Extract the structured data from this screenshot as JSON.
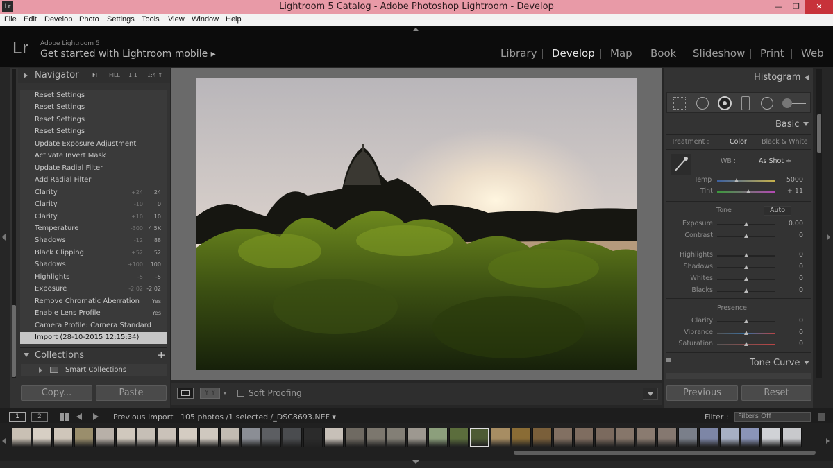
{
  "window": {
    "title": "Lightroom 5 Catalog - Adobe Photoshop Lightroom - Develop",
    "app_icon": "Lr",
    "min_glyph": "—",
    "max_glyph": "❐",
    "close_glyph": "✕"
  },
  "menu": [
    "File",
    "Edit",
    "Develop",
    "Photo",
    "Settings",
    "Tools",
    "View",
    "Window",
    "Help"
  ],
  "identity": {
    "logo": "Lr",
    "product": "Adobe Lightroom 5",
    "mobile": "Get started with Lightroom mobile ▸"
  },
  "modules": [
    "Library",
    "Develop",
    "Map",
    "Book",
    "Slideshow",
    "Print",
    "Web"
  ],
  "active_module": "Develop",
  "navigator": {
    "title": "Navigator",
    "options": [
      "FIT",
      "FILL",
      "1:1",
      "1:4 ⇕"
    ]
  },
  "history": [
    {
      "label": "Reset Settings",
      "v1": "",
      "v2": ""
    },
    {
      "label": "Reset Settings",
      "v1": "",
      "v2": ""
    },
    {
      "label": "Reset Settings",
      "v1": "",
      "v2": ""
    },
    {
      "label": "Reset Settings",
      "v1": "",
      "v2": ""
    },
    {
      "label": "Update Exposure Adjustment",
      "v1": "",
      "v2": ""
    },
    {
      "label": "Activate Invert Mask",
      "v1": "",
      "v2": ""
    },
    {
      "label": "Update Radial Filter",
      "v1": "",
      "v2": ""
    },
    {
      "label": "Add Radial Filter",
      "v1": "",
      "v2": ""
    },
    {
      "label": "Clarity",
      "v1": "+24",
      "v2": "24"
    },
    {
      "label": "Clarity",
      "v1": "-10",
      "v2": "0"
    },
    {
      "label": "Clarity",
      "v1": "+10",
      "v2": "10"
    },
    {
      "label": "Temperature",
      "v1": "-300",
      "v2": "4.5K"
    },
    {
      "label": "Shadows",
      "v1": "-12",
      "v2": "88"
    },
    {
      "label": "Black Clipping",
      "v1": "+52",
      "v2": "52"
    },
    {
      "label": "Shadows",
      "v1": "+100",
      "v2": "100"
    },
    {
      "label": "Highlights",
      "v1": "-5",
      "v2": "-5"
    },
    {
      "label": "Exposure",
      "v1": "-2.02",
      "v2": "-2.02"
    },
    {
      "label": "Remove Chromatic Aberration",
      "v1": "",
      "v2": "Yes"
    },
    {
      "label": "Enable Lens Profile",
      "v1": "",
      "v2": "Yes"
    },
    {
      "label": "Camera Profile: Camera Standard",
      "v1": "",
      "v2": ""
    },
    {
      "label": "Import (28-10-2015 12:15:34)",
      "v1": "",
      "v2": ""
    }
  ],
  "collections": {
    "title": "Collections",
    "plus": "+",
    "smart": "Smart Collections"
  },
  "left_buttons": {
    "copy": "Copy...",
    "paste": "Paste"
  },
  "toolbar": {
    "soft_proofing": "Soft Proofing",
    "yy": "Y|Y"
  },
  "right": {
    "histogram": "Histogram",
    "basic": "Basic",
    "treatment_label": "Treatment :",
    "treatment_color": "Color",
    "treatment_bw": "Black & White",
    "wb_label": "WB :",
    "wb_value": "As Shot ÷",
    "temp_label": "Temp",
    "temp_value": "5000",
    "tint_label": "Tint",
    "tint_value": "+ 11",
    "tone_label": "Tone",
    "auto_label": "Auto",
    "presence_label": "Presence",
    "tone_curve": "Tone Curve",
    "previous": "Previous",
    "reset": "Reset"
  },
  "sliders": [
    {
      "label": "Exposure",
      "value": "0.00",
      "pos": 0.5
    },
    {
      "label": "Contrast",
      "value": "0",
      "pos": 0.5
    },
    {
      "label": "Highlights",
      "value": "0",
      "pos": 0.5
    },
    {
      "label": "Shadows",
      "value": "0",
      "pos": 0.5
    },
    {
      "label": "Whites",
      "value": "0",
      "pos": 0.5
    },
    {
      "label": "Blacks",
      "value": "0",
      "pos": 0.5
    },
    {
      "label": "Clarity",
      "value": "0",
      "pos": 0.5
    },
    {
      "label": "Vibrance",
      "value": "0",
      "pos": 0.5
    },
    {
      "label": "Saturation",
      "value": "0",
      "pos": 0.5
    }
  ],
  "temp_pos": 0.33,
  "tint_pos": 0.53,
  "filmstrip": {
    "page1": "1",
    "page2": "2",
    "previous_import": "Previous Import",
    "count": "105 photos /1 selected /_DSC8693.NEF ▾",
    "filter_label": "Filter :",
    "filter_value": "Filters Off"
  },
  "colors": {
    "titlebar": "#e89aa7",
    "panel": "#333333",
    "history_selected": "#c6c6c6",
    "center_bg": "#6a6a6a"
  }
}
